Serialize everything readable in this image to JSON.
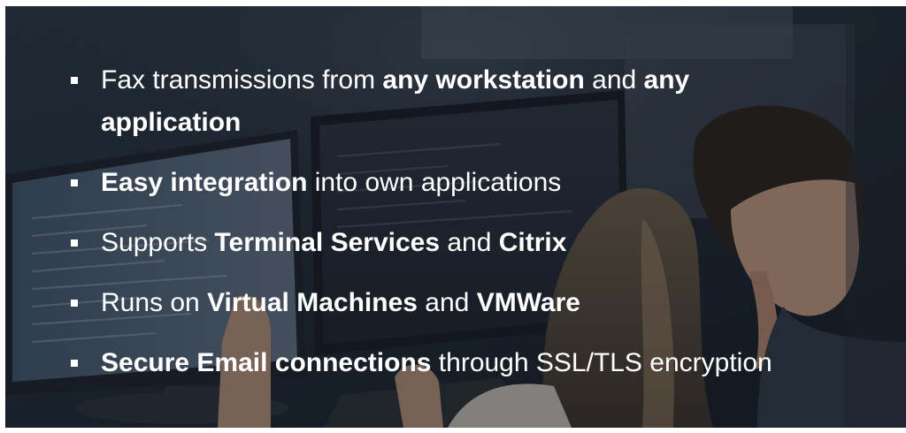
{
  "features": [
    {
      "p1": "Fax transmissions from ",
      "b1": "any workstation",
      "p2": " and ",
      "b2": "any application",
      "p3": ""
    },
    {
      "p1": "",
      "b1": "Easy integration",
      "p2": " into own applications",
      "b2": "",
      "p3": ""
    },
    {
      "p1": "Supports ",
      "b1": "Terminal Services",
      "p2": " and ",
      "b2": "Citrix",
      "p3": ""
    },
    {
      "p1": "Runs on ",
      "b1": "Virtual Machines",
      "p2": " and ",
      "b2": "VMWare",
      "p3": ""
    },
    {
      "p1": "",
      "b1": "Secure Email connections",
      "p2": " through SSL/TLS encryption",
      "b2": "",
      "p3": ""
    }
  ],
  "colors": {
    "text": "#ffffff",
    "background": "#1b232b",
    "bullet": "#ffffff"
  },
  "icons": {
    "bullet": "square-bullet-icon"
  }
}
